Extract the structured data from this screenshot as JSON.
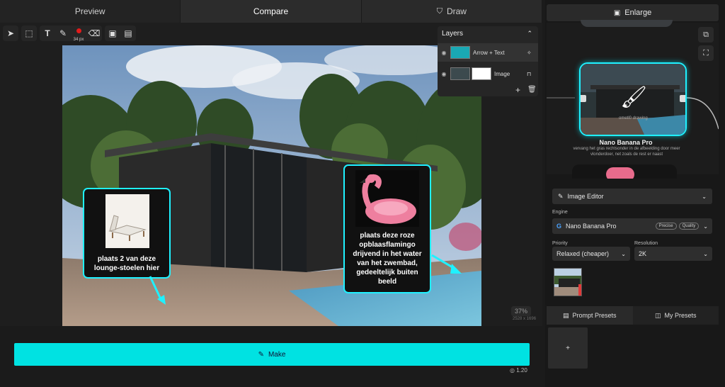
{
  "top_tabs": [
    "Preview",
    "Compare",
    "Draw"
  ],
  "toolbar": {
    "brush_size": "34 px"
  },
  "layers": {
    "title": "Layers",
    "items": [
      {
        "name": "Arrow + Text"
      },
      {
        "name": "Image"
      }
    ]
  },
  "canvas": {
    "zoom": "37%",
    "dimensions": "2528 x 1696",
    "callouts": [
      {
        "text": "plaats 2 van deze lounge-stoelen hier"
      },
      {
        "text": "plaats deze roze opblaasflamingo drijvend in het water van het zwembad, gedeeltelijk buiten beeld"
      }
    ]
  },
  "make_button": {
    "label": "Make"
  },
  "credits": "1.20",
  "right_panel": {
    "enlarge_tab": "Enlarge",
    "node": {
      "title": "Nano Banana Pro",
      "description": "vervang het gras rechtsonder in de afbeelding door meer vlonderdoer, net zoals de rest er naast",
      "overlay_text": "ometl0 drawing"
    },
    "tool_select": "Image Editor",
    "engine_label": "Engine",
    "engine_value": "Nano Banana Pro",
    "engine_badges": [
      "Precise",
      "Quality"
    ],
    "priority_label": "Priority",
    "priority_value": "Relaxed (cheaper)",
    "resolution_label": "Resolution",
    "resolution_value": "2K",
    "preset_tabs": [
      "Prompt Presets",
      "My Presets"
    ],
    "add_label": "+"
  },
  "colors": {
    "accent": "#00e2e2",
    "node_border": "#1ff1ff",
    "brush_dot": "#e21b1b"
  }
}
